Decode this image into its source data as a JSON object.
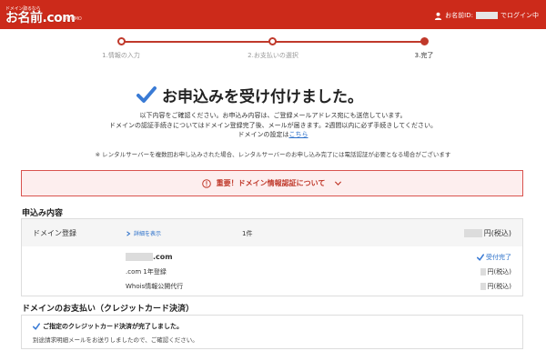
{
  "header": {
    "logo_tagline": "ドメイン取るなら",
    "logo_text": "お名前.com",
    "logo_sub": "by GMO",
    "login_prefix": "お名前ID:",
    "login_suffix": "でログイン中"
  },
  "steps": [
    {
      "label": "1.情報の入力",
      "state": "done"
    },
    {
      "label": "2.お支払いの選択",
      "state": "done"
    },
    {
      "label": "3.完了",
      "state": "current"
    }
  ],
  "title": "お申込みを受け付けました。",
  "lead": {
    "line1": "以下内容をご確認ください。お申込み内容は、ご登録メールアドレス宛にも送信しています。",
    "line2": "ドメインの認証手続きについてはドメイン登録完了後、メールが届きます。2週間以内に必ず手続きしてください。",
    "line3_prefix": "ドメインの設定は",
    "line3_link": "こちら"
  },
  "note": "※ レンタルサーバーを複数回お申し込みされた場合、レンタルサーバーのお申し込み完了には電話認証が必要となる場合がございます",
  "important": {
    "label": "重要！ドメイン情報認証について"
  },
  "order": {
    "section_title": "申込み内容",
    "head_label": "ドメイン登録",
    "detail_link": "詳細を表示",
    "quantity": "1件",
    "price_suffix": "円(税込)",
    "domain_suffix": ".com",
    "status": "受付完了",
    "items": [
      {
        "label": ".com 1年登録",
        "price_suffix": "円(税込)"
      },
      {
        "label": "Whois情報公開代行",
        "price_suffix": "円(税込)"
      }
    ]
  },
  "payment": {
    "section_title": "ドメインのお支払い（クレジットカード決済）",
    "line1": "ご指定のクレジットカード決済が完了しました。",
    "line2": "別途請求明細メールをお送りしましたので、ご確認ください。"
  },
  "colors": {
    "brand_red": "#cc2a1a",
    "link_blue": "#2a6fc9",
    "check_blue": "#3a7bd5"
  }
}
